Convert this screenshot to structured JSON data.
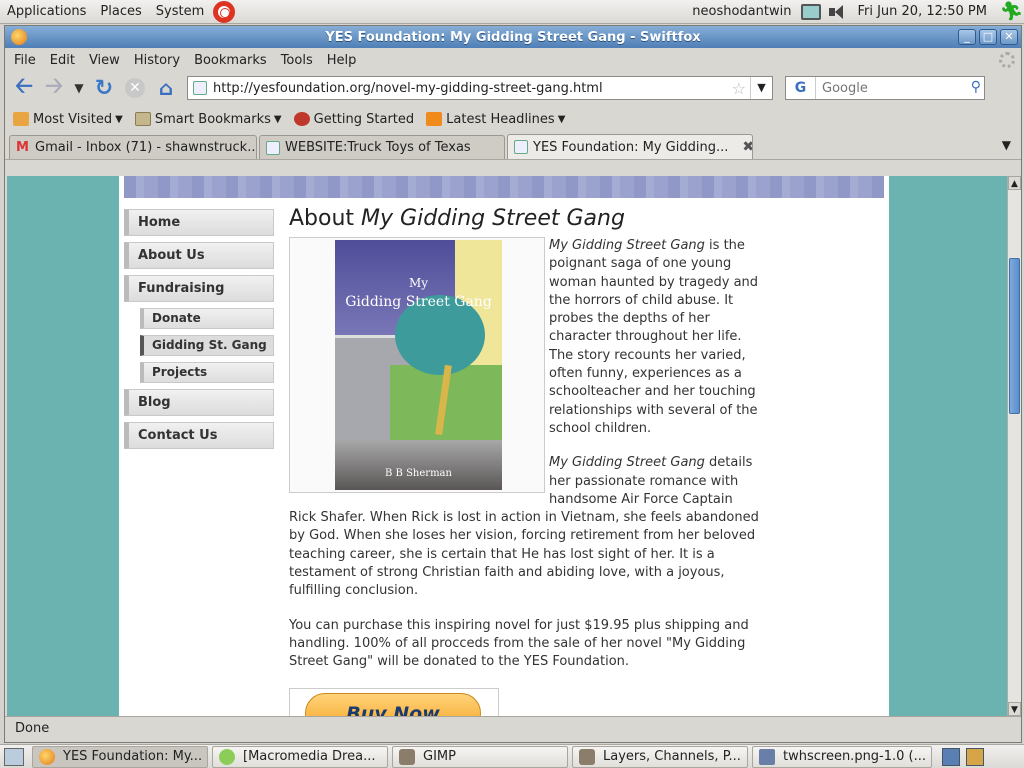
{
  "top_panel": {
    "menus": [
      "Applications",
      "Places",
      "System"
    ],
    "username": "neoshodantwin",
    "clock": "Fri Jun 20, 12:50 PM"
  },
  "window": {
    "title": "YES Foundation: My Gidding Street Gang - Swiftfox",
    "menu": [
      "File",
      "Edit",
      "View",
      "History",
      "Bookmarks",
      "Tools",
      "Help"
    ],
    "url": "http://yesfoundation.org/novel-my-gidding-street-gang.html",
    "search_placeholder": "Google",
    "bookmarks": [
      "Most Visited",
      "Smart Bookmarks",
      "Getting Started",
      "Latest Headlines"
    ],
    "tabs": [
      {
        "label": "Gmail - Inbox (71) - shawnstruck..."
      },
      {
        "label": "WEBSITE:Truck Toys of Texas"
      },
      {
        "label": "YES Foundation: My Gidding..."
      }
    ],
    "status": "Done"
  },
  "page": {
    "nav": {
      "home": "Home",
      "about": "About Us",
      "fundraising": "Fundraising",
      "donate": "Donate",
      "gidding": "Gidding St. Gang",
      "projects": "Projects",
      "blog": "Blog",
      "contact": "Contact Us"
    },
    "heading_prefix": "About ",
    "heading_title": "My Gidding Street Gang",
    "cover": {
      "line1": "My",
      "line2": "Gidding Street Gang",
      "author": "B B Sherman"
    },
    "p1_title": "My Gidding Street Gang",
    "p1_text": " is the poignant saga of one young woman haunted by tragedy and the horrors of child abuse. It probes the depths of her character throughout her life. The story recounts her varied, often funny, experiences as a schoolteacher and her touching relationships with several of the school children.",
    "p2_title": "My Gidding Street Gang",
    "p2_text": " details her passionate romance with handsome Air Force Captain Rick Shafer. When Rick is lost in action in Vietnam, she feels abandoned by God. When she loses her vision, forcing retirement from her beloved teaching career, she is certain that He has lost sight of her. It is a testament of strong Christian faith and abiding love, with a joyous, fulfilling conclusion.",
    "p3_text": "You can purchase this inspiring novel for just $19.95 plus shipping and handling. 100% of all procceds from the sale of her novel \"My Gidding Street Gang\" will be donated to the YES Foundation.",
    "buy_label": "Buy Now"
  },
  "taskbar": [
    "YES Foundation: My...",
    "[Macromedia Drea...",
    "GIMP",
    "Layers, Channels, P...",
    "twhscreen.png-1.0 (..."
  ]
}
